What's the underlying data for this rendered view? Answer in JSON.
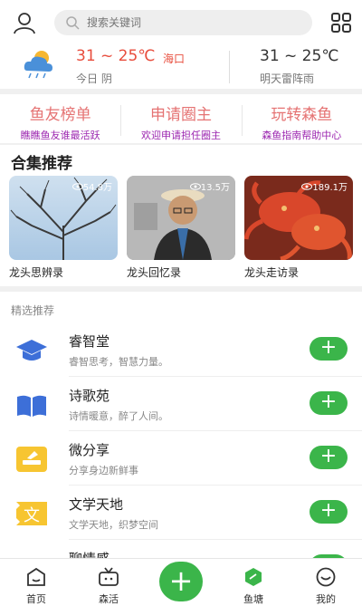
{
  "search": {
    "placeholder": "搜索关键词"
  },
  "weather": {
    "today_temp": "31 ~ 25℃",
    "city": "海口",
    "today_desc": "今日 阴",
    "tomorrow_temp": "31 ~ 25℃",
    "tomorrow_desc": "明天雷阵雨"
  },
  "promo": [
    {
      "title": "鱼友榜单",
      "sub": "瞧瞧鱼友谁最活跃"
    },
    {
      "title": "申请圈主",
      "sub": "欢迎申请担任圈主"
    },
    {
      "title": "玩转森鱼",
      "sub": "森鱼指南帮助中心"
    }
  ],
  "collections": {
    "title": "合集推荐",
    "items": [
      {
        "caption": "龙头思辨录",
        "views": "54.8万"
      },
      {
        "caption": "龙头回忆录",
        "views": "13.5万"
      },
      {
        "caption": "龙头走访录",
        "views": "189.1万"
      }
    ]
  },
  "picks": {
    "label": "精选推荐",
    "items": [
      {
        "name": "睿智堂",
        "desc": "睿智思考，智慧力量。",
        "icon": "graduation-cap-icon"
      },
      {
        "name": "诗歌苑",
        "desc": "诗情暖意，醉了人间。",
        "icon": "open-book-icon"
      },
      {
        "name": "微分享",
        "desc": "分享身边新鲜事",
        "icon": "note-icon"
      },
      {
        "name": "文学天地",
        "desc": "文学天地，织梦空间",
        "icon": "wen-character-icon"
      },
      {
        "name": "聊情感",
        "desc": "",
        "icon": "heart-icon"
      }
    ]
  },
  "tabs": [
    {
      "label": "首页",
      "icon": "home-icon"
    },
    {
      "label": "森活",
      "icon": "tv-icon"
    },
    {
      "label": "鱼塘",
      "icon": "hexagon-icon"
    },
    {
      "label": "我的",
      "icon": "smile-icon"
    }
  ],
  "colors": {
    "accent_green": "#3bb54a",
    "temp_red": "#e84d3d",
    "promo_red": "#e57373",
    "promo_purple": "#9c27b0"
  }
}
